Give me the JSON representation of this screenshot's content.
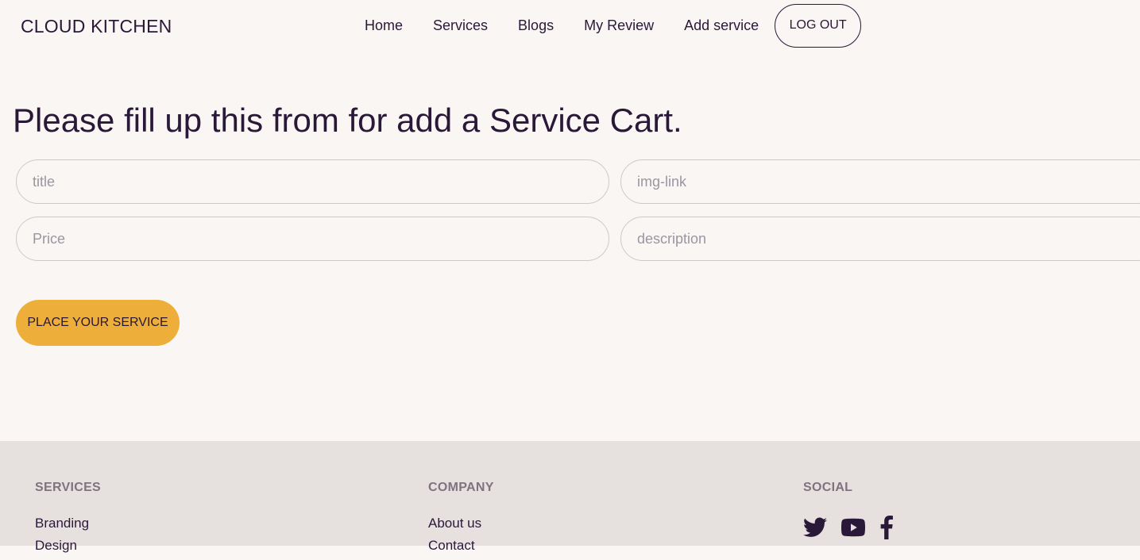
{
  "header": {
    "brand": "CLOUD KITCHEN",
    "nav": [
      {
        "label": "Home"
      },
      {
        "label": "Services"
      },
      {
        "label": "Blogs"
      },
      {
        "label": "My Review"
      },
      {
        "label": "Add service"
      }
    ],
    "logout_label": "LOG OUT"
  },
  "form": {
    "heading": "Please fill up this from for add a Service Cart.",
    "title_placeholder": "title",
    "img_placeholder": "img-link",
    "price_placeholder": "Price",
    "description_placeholder": "description",
    "submit_label": "PLACE YOUR SERVICE"
  },
  "footer": {
    "services": {
      "heading": "SERVICES",
      "links": [
        "Branding",
        "Design"
      ]
    },
    "company": {
      "heading": "COMPANY",
      "links": [
        "About us",
        "Contact"
      ]
    },
    "social": {
      "heading": "SOCIAL",
      "icons": [
        "twitter-icon",
        "youtube-icon",
        "facebook-icon"
      ]
    }
  },
  "colors": {
    "background": "#faf6f4",
    "text": "#2a1838",
    "accent": "#eeae3a",
    "footer_bg": "#e6e0de"
  }
}
